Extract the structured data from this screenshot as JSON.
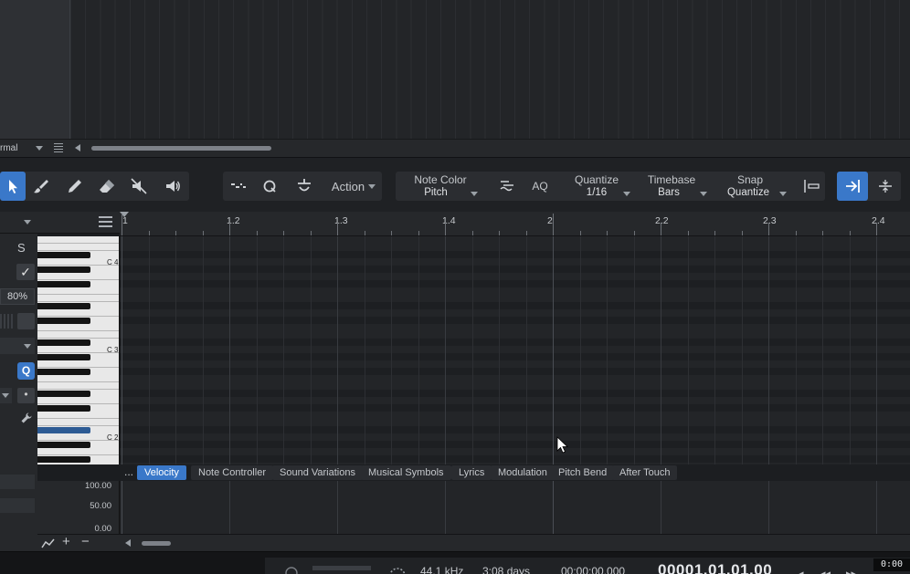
{
  "arrange": {
    "mode_label": "rmal"
  },
  "toolbar": {
    "tools": [
      {
        "name": "arrow-tool",
        "icon": "arrow-icon",
        "active": true
      },
      {
        "name": "paint-tool",
        "icon": "brush-icon",
        "active": false
      },
      {
        "name": "pencil-tool",
        "icon": "pencil-icon",
        "active": false
      },
      {
        "name": "eraser-tool",
        "icon": "eraser-icon",
        "active": false
      },
      {
        "name": "mute-tool",
        "icon": "mute-icon",
        "active": false
      },
      {
        "name": "listen-tool",
        "icon": "speaker-icon",
        "active": false
      }
    ],
    "action_label": "Action",
    "note_color": {
      "label": "Note Color",
      "value": "Pitch"
    },
    "aq_label": "AQ",
    "quantize": {
      "label": "Quantize",
      "value": "1/16"
    },
    "timebase": {
      "label": "Timebase",
      "value": "Bars"
    },
    "snap": {
      "label": "Snap",
      "value": "Quantize"
    }
  },
  "inspector": {
    "solo_label": "S",
    "check_glyph": "✓",
    "velocity_pct": "80%",
    "q_label": "Q",
    "dot_glyph": "•",
    "wrench_glyph": "🔧"
  },
  "piano": {
    "octave_labels": [
      "C 4",
      "C 3",
      "C 2"
    ]
  },
  "ruler": {
    "labels": [
      "1",
      "1.2",
      "1.3",
      "1.4",
      "2",
      "2.2",
      "2.3",
      "2.4"
    ]
  },
  "tabs": {
    "more": "...",
    "items": [
      {
        "label": "Velocity",
        "active": true
      },
      {
        "label": "Note Controller",
        "active": false
      },
      {
        "label": "Sound Variations",
        "active": false
      },
      {
        "label": "Musical Symbols",
        "active": false
      },
      {
        "label": "Lyrics",
        "active": false
      },
      {
        "label": "Modulation",
        "active": false
      },
      {
        "label": "Pitch Bend",
        "active": false
      },
      {
        "label": "After Touch",
        "active": false
      }
    ]
  },
  "automation": {
    "scale": [
      "100.00",
      "50.00",
      "0.00"
    ]
  },
  "lane_toolbar": {
    "plus": "+",
    "minus": "−"
  },
  "transport": {
    "sample_rate": "44.1 kHz",
    "record_time": "3:08 days",
    "time_code": "00:00:00.000",
    "position": "00001.01.01.00",
    "clock": "0:00"
  },
  "colors": {
    "accent": "#3a78c9",
    "background": "#1b1d20"
  }
}
